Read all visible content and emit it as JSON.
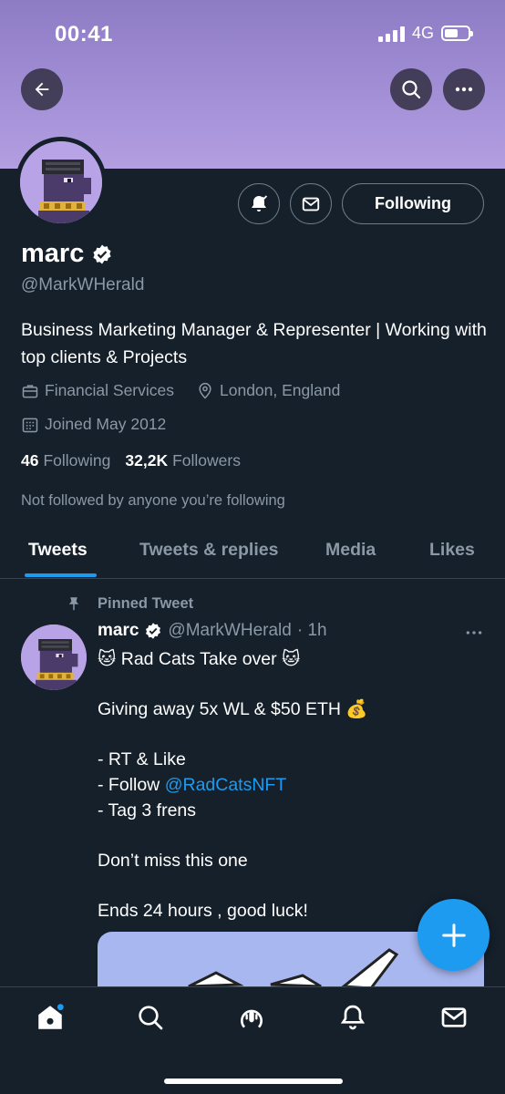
{
  "status_bar": {
    "time": "00:41",
    "network": "4G"
  },
  "profile": {
    "name": "marc",
    "handle": "@MarkWHerald",
    "bio": "Business Marketing Manager & Representer | Working with top clients & Projects",
    "category": "Financial Services",
    "location": "London, England",
    "joined": "Joined May 2012",
    "following_count": "46",
    "following_label": "Following",
    "followers_count": "32,2K",
    "followers_label": "Followers",
    "not_followed": "Not followed by anyone you’re following",
    "follow_button_label": "Following"
  },
  "tabs": [
    {
      "label": "Tweets",
      "active": true
    },
    {
      "label": "Tweets & replies",
      "active": false
    },
    {
      "label": "Media",
      "active": false
    },
    {
      "label": "Likes",
      "active": false
    }
  ],
  "tweet": {
    "pinned_label": "Pinned Tweet",
    "author_name": "marc",
    "author_handle": "@MarkWHerald",
    "time": "· 1h",
    "lines": [
      "🐱 Rad Cats Take over 🐱",
      "",
      "Giving away 5x WL & $50 ETH 💰",
      "",
      "- RT & Like",
      "- Follow ",
      "- Tag 3 frens",
      "",
      "Don’t miss this one",
      "",
      "Ends 24 hours , good luck!"
    ],
    "mention": "@RadCatsNFT"
  },
  "icons": {
    "back": "back-arrow-icon",
    "search": "search-icon",
    "more": "more-icon",
    "notify": "bell-check-icon",
    "message": "mail-icon",
    "verified": "verified-badge-icon",
    "briefcase": "briefcase-icon",
    "location": "location-pin-icon",
    "calendar": "calendar-icon",
    "pin": "pin-icon"
  },
  "colors": {
    "background": "#15202b",
    "banner": "#a28fd6",
    "accent": "#1d9bf0",
    "secondary_text": "#8b98a5",
    "border": "#38444d"
  }
}
